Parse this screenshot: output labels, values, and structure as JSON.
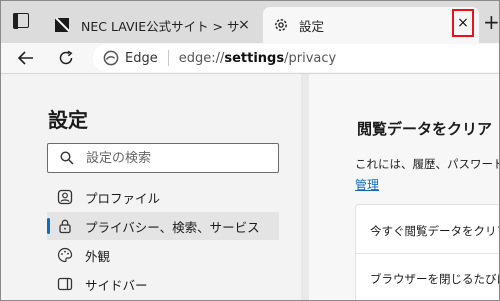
{
  "tabs": [
    {
      "title": "NEC LAVIE公式サイト > サービス&サポート",
      "close": "×"
    },
    {
      "title": "設定",
      "close": "×"
    }
  ],
  "new_tab": "+",
  "address": {
    "label": "Edge",
    "url_prefix": "edge://",
    "url_bold": "settings",
    "url_suffix": "/privacy"
  },
  "sidebar": {
    "title": "設定",
    "search_placeholder": "設定の検索",
    "items": [
      {
        "label": "プロファイル",
        "icon": "profile-icon"
      },
      {
        "label": "プライバシー、検索、サービス",
        "icon": "lock-icon",
        "active": true
      },
      {
        "label": "外観",
        "icon": "appearance-icon"
      },
      {
        "label": "サイドバー",
        "icon": "sidebar-icon"
      }
    ]
  },
  "main": {
    "section_title": "閲覧データをクリア",
    "description": "これには、履歴、パスワード、Cookie などが含まれます。",
    "manage_link": "管理",
    "rows": [
      "今すぐ閲覧データをクリア",
      "ブラウザーを閉じるたびにクリアするデータを選択"
    ]
  },
  "colors": {
    "accent": "#0f6cbd",
    "highlight": "#e8121b"
  }
}
